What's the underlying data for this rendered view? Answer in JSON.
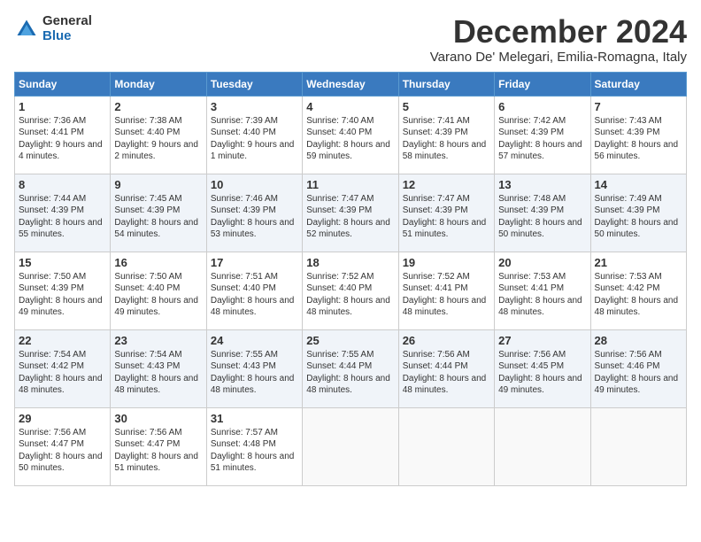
{
  "logo": {
    "general": "General",
    "blue": "Blue"
  },
  "title": {
    "month": "December 2024",
    "location": "Varano De' Melegari, Emilia-Romagna, Italy"
  },
  "headers": [
    "Sunday",
    "Monday",
    "Tuesday",
    "Wednesday",
    "Thursday",
    "Friday",
    "Saturday"
  ],
  "weeks": [
    [
      {
        "day": "1",
        "text": "Sunrise: 7:36 AM\nSunset: 4:41 PM\nDaylight: 9 hours and 4 minutes."
      },
      {
        "day": "2",
        "text": "Sunrise: 7:38 AM\nSunset: 4:40 PM\nDaylight: 9 hours and 2 minutes."
      },
      {
        "day": "3",
        "text": "Sunrise: 7:39 AM\nSunset: 4:40 PM\nDaylight: 9 hours and 1 minute."
      },
      {
        "day": "4",
        "text": "Sunrise: 7:40 AM\nSunset: 4:40 PM\nDaylight: 8 hours and 59 minutes."
      },
      {
        "day": "5",
        "text": "Sunrise: 7:41 AM\nSunset: 4:39 PM\nDaylight: 8 hours and 58 minutes."
      },
      {
        "day": "6",
        "text": "Sunrise: 7:42 AM\nSunset: 4:39 PM\nDaylight: 8 hours and 57 minutes."
      },
      {
        "day": "7",
        "text": "Sunrise: 7:43 AM\nSunset: 4:39 PM\nDaylight: 8 hours and 56 minutes."
      }
    ],
    [
      {
        "day": "8",
        "text": "Sunrise: 7:44 AM\nSunset: 4:39 PM\nDaylight: 8 hours and 55 minutes."
      },
      {
        "day": "9",
        "text": "Sunrise: 7:45 AM\nSunset: 4:39 PM\nDaylight: 8 hours and 54 minutes."
      },
      {
        "day": "10",
        "text": "Sunrise: 7:46 AM\nSunset: 4:39 PM\nDaylight: 8 hours and 53 minutes."
      },
      {
        "day": "11",
        "text": "Sunrise: 7:47 AM\nSunset: 4:39 PM\nDaylight: 8 hours and 52 minutes."
      },
      {
        "day": "12",
        "text": "Sunrise: 7:47 AM\nSunset: 4:39 PM\nDaylight: 8 hours and 51 minutes."
      },
      {
        "day": "13",
        "text": "Sunrise: 7:48 AM\nSunset: 4:39 PM\nDaylight: 8 hours and 50 minutes."
      },
      {
        "day": "14",
        "text": "Sunrise: 7:49 AM\nSunset: 4:39 PM\nDaylight: 8 hours and 50 minutes."
      }
    ],
    [
      {
        "day": "15",
        "text": "Sunrise: 7:50 AM\nSunset: 4:39 PM\nDaylight: 8 hours and 49 minutes."
      },
      {
        "day": "16",
        "text": "Sunrise: 7:50 AM\nSunset: 4:40 PM\nDaylight: 8 hours and 49 minutes."
      },
      {
        "day": "17",
        "text": "Sunrise: 7:51 AM\nSunset: 4:40 PM\nDaylight: 8 hours and 48 minutes."
      },
      {
        "day": "18",
        "text": "Sunrise: 7:52 AM\nSunset: 4:40 PM\nDaylight: 8 hours and 48 minutes."
      },
      {
        "day": "19",
        "text": "Sunrise: 7:52 AM\nSunset: 4:41 PM\nDaylight: 8 hours and 48 minutes."
      },
      {
        "day": "20",
        "text": "Sunrise: 7:53 AM\nSunset: 4:41 PM\nDaylight: 8 hours and 48 minutes."
      },
      {
        "day": "21",
        "text": "Sunrise: 7:53 AM\nSunset: 4:42 PM\nDaylight: 8 hours and 48 minutes."
      }
    ],
    [
      {
        "day": "22",
        "text": "Sunrise: 7:54 AM\nSunset: 4:42 PM\nDaylight: 8 hours and 48 minutes."
      },
      {
        "day": "23",
        "text": "Sunrise: 7:54 AM\nSunset: 4:43 PM\nDaylight: 8 hours and 48 minutes."
      },
      {
        "day": "24",
        "text": "Sunrise: 7:55 AM\nSunset: 4:43 PM\nDaylight: 8 hours and 48 minutes."
      },
      {
        "day": "25",
        "text": "Sunrise: 7:55 AM\nSunset: 4:44 PM\nDaylight: 8 hours and 48 minutes."
      },
      {
        "day": "26",
        "text": "Sunrise: 7:56 AM\nSunset: 4:44 PM\nDaylight: 8 hours and 48 minutes."
      },
      {
        "day": "27",
        "text": "Sunrise: 7:56 AM\nSunset: 4:45 PM\nDaylight: 8 hours and 49 minutes."
      },
      {
        "day": "28",
        "text": "Sunrise: 7:56 AM\nSunset: 4:46 PM\nDaylight: 8 hours and 49 minutes."
      }
    ],
    [
      {
        "day": "29",
        "text": "Sunrise: 7:56 AM\nSunset: 4:47 PM\nDaylight: 8 hours and 50 minutes."
      },
      {
        "day": "30",
        "text": "Sunrise: 7:56 AM\nSunset: 4:47 PM\nDaylight: 8 hours and 51 minutes."
      },
      {
        "day": "31",
        "text": "Sunrise: 7:57 AM\nSunset: 4:48 PM\nDaylight: 8 hours and 51 minutes."
      },
      {
        "day": "",
        "text": ""
      },
      {
        "day": "",
        "text": ""
      },
      {
        "day": "",
        "text": ""
      },
      {
        "day": "",
        "text": ""
      }
    ]
  ]
}
